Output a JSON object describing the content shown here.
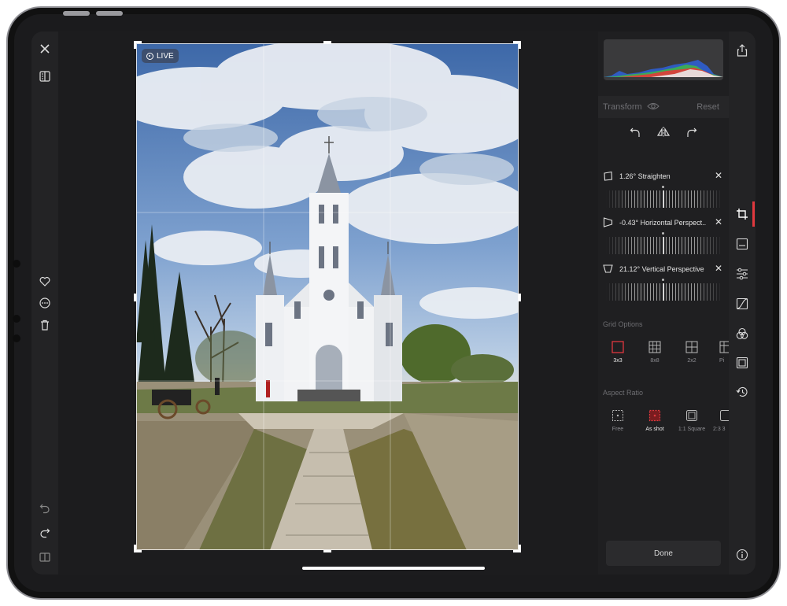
{
  "photo": {
    "live_badge": "LIVE"
  },
  "left_toolbar": {
    "icons": [
      "close-icon",
      "compare-icon",
      "heart-icon",
      "more-icon",
      "trash-icon",
      "undo-icon",
      "redo-icon",
      "split-view-icon"
    ]
  },
  "transform_panel": {
    "title": "Transform",
    "reset_label": "Reset",
    "adjustments": [
      {
        "label": "1.26° Straighten",
        "icon": "straighten-icon"
      },
      {
        "label": "-0.43° Horizontal Perspect...",
        "icon": "horizontal-perspective-icon"
      },
      {
        "label": "21.12° Vertical Perspective",
        "icon": "vertical-perspective-icon"
      }
    ],
    "grid_options": {
      "title": "Grid Options",
      "options": [
        "3x3",
        "8x8",
        "2x2",
        "Pi"
      ],
      "selected": "3x3"
    },
    "aspect_ratio": {
      "title": "Aspect Ratio",
      "options": [
        "Free",
        "As shot",
        "1:1 Square",
        "2:3 3"
      ],
      "selected": "As shot"
    },
    "done_label": "Done"
  },
  "right_toolbar": {
    "icons": [
      "share-icon",
      "crop-icon",
      "image-icon",
      "adjust-sliders-icon",
      "curves-icon",
      "color-mix-icon",
      "frame-icon",
      "history-icon",
      "info-icon"
    ],
    "active": "crop-icon"
  },
  "colors": {
    "accent": "#e0383e",
    "background": "#1c1c1e"
  }
}
